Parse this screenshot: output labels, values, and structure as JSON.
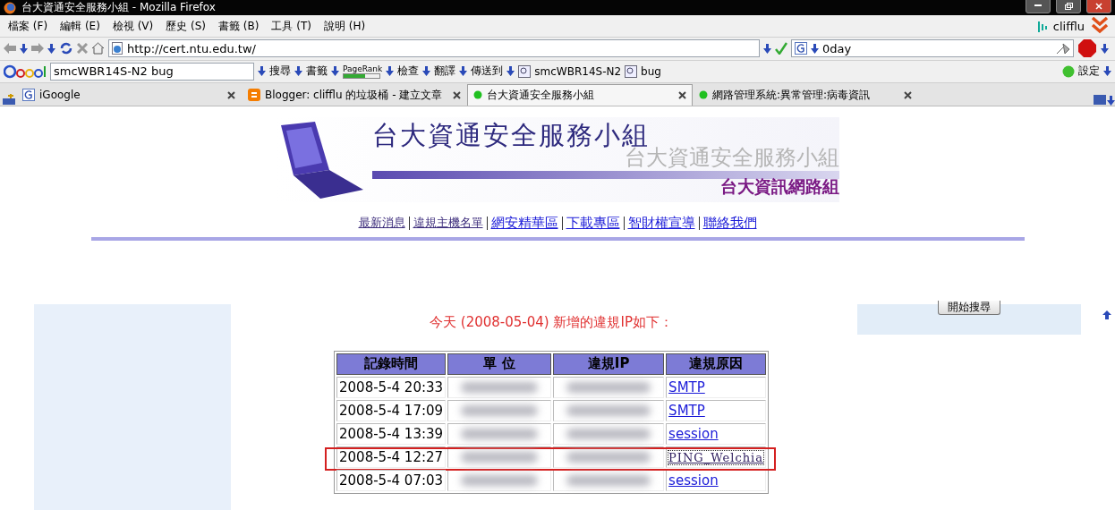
{
  "window": {
    "title": "台大資通安全服務小組 - Mozilla Firefox"
  },
  "menu": [
    "檔案 (F)",
    "編輯 (E)",
    "檢視 (V)",
    "歷史 (S)",
    "書籤 (B)",
    "工具 (T)",
    "說明 (H)"
  ],
  "account": "clifflu",
  "address": {
    "value": "http://cert.ntu.edu.tw/"
  },
  "search": {
    "value": "0day"
  },
  "google_toolbar": {
    "query": "smcWBR14S-N2 bug",
    "items": [
      {
        "kind": "text",
        "label": "搜尋"
      },
      {
        "kind": "text",
        "label": "書籤"
      },
      {
        "kind": "pagerank",
        "label": "PageRank",
        "level": 0.6
      },
      {
        "kind": "text",
        "label": "檢查"
      },
      {
        "kind": "text",
        "label": "翻譯"
      },
      {
        "kind": "text",
        "label": "傳送到"
      },
      {
        "kind": "highlight",
        "label": "smcWBR14S-N2"
      },
      {
        "kind": "highlight",
        "label": "bug"
      }
    ],
    "settings": "設定"
  },
  "tabs": [
    {
      "label": "iGoogle",
      "kind": "google",
      "selected": false
    },
    {
      "label": "Blogger: clifflu 的垃圾桶 - 建立文章",
      "kind": "blogger",
      "selected": false
    },
    {
      "label": "台大資通安全服務小組",
      "kind": "status",
      "selected": true
    },
    {
      "label": "網路管理系統:異常管理:病毒資訊",
      "kind": "status",
      "selected": false
    }
  ],
  "banner": {
    "title": "台大資通安全服務小組",
    "shadow_title": "台大資通安全服務小組",
    "subtitle": "台大資訊網路組"
  },
  "nav_links": [
    {
      "label": "最新消息",
      "visited": true
    },
    {
      "label": "違規主機名單",
      "visited": true
    },
    {
      "label": "網安精華區",
      "visited": false
    },
    {
      "label": "下載專區",
      "visited": false
    },
    {
      "label": "智財權宣導",
      "visited": false
    },
    {
      "label": "聯絡我們",
      "visited": false
    }
  ],
  "search_button": "開始搜尋",
  "notice": "今天 (2008-05-04) 新增的違規IP如下：",
  "table": {
    "columns": [
      "記錄時間",
      "單 位",
      "違規IP",
      "違規原因"
    ],
    "rows": [
      {
        "time": "2008-5-4 20:33",
        "reason": "SMTP",
        "highlighted": false,
        "focused": false
      },
      {
        "time": "2008-5-4 17:09",
        "reason": "SMTP",
        "highlighted": false,
        "focused": false
      },
      {
        "time": "2008-5-4 13:39",
        "reason": "session",
        "highlighted": false,
        "focused": false
      },
      {
        "time": "2008-5-4 12:27",
        "reason": "PING_Welchia",
        "highlighted": true,
        "focused": true
      },
      {
        "time": "2008-5-4 07:03",
        "reason": "session",
        "highlighted": false,
        "focused": false
      }
    ]
  }
}
